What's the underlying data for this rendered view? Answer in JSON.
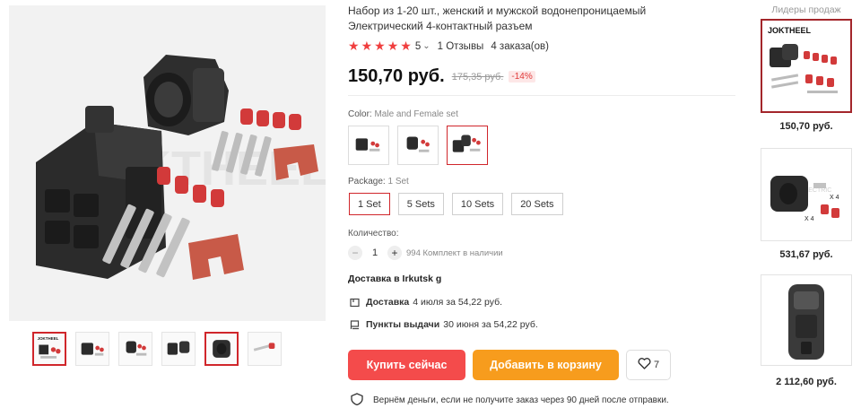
{
  "product": {
    "title": "Набор из 1-20 шт., женский и мужской водонепроницаемый Электрический 4-контактный разъем",
    "rating_value": "5",
    "reviews": "1 Отзывы",
    "orders": "4 заказа(ов)",
    "price": "150,70 руб.",
    "old_price": "175,35 руб.",
    "discount": "-14%",
    "watermark": "JOKTHEEL"
  },
  "gallery": {
    "thumb_count": 6,
    "active_index": 0
  },
  "color": {
    "label": "Color:",
    "selected": "Male and Female set",
    "options": [
      "female",
      "male",
      "male-and-female-set"
    ],
    "active_index": 2
  },
  "package": {
    "label": "Package:",
    "selected": "1 Set",
    "options": [
      "1 Set",
      "5 Sets",
      "10 Sets",
      "20 Sets"
    ],
    "active_index": 0
  },
  "quantity": {
    "label": "Количество:",
    "value": "1",
    "minus": "−",
    "plus": "+",
    "stock": "994 Комплект в наличии"
  },
  "delivery": {
    "heading": "Доставка в Irkutsk g",
    "courier_label": "Доставка",
    "courier_text": "4 июля за 54,22 руб.",
    "pickup_label": "Пункты выдачи",
    "pickup_text": "30 июня за 54,22 руб."
  },
  "actions": {
    "buy_now": "Купить сейчас",
    "add_to_cart": "Добавить в корзину",
    "wishlist_count": "7"
  },
  "guarantee": {
    "text": "Вернём деньги, если не получите заказ через 90 дней после отправки."
  },
  "sidebar": {
    "title": "Лидеры продаж",
    "items": [
      {
        "brand": "JOKTHEEL",
        "price": "150,70 руб."
      },
      {
        "brand": "ANZHE ELECTRIC",
        "price": "531,67 руб.",
        "qty_a": "X 4",
        "qty_b": "X 4"
      },
      {
        "price": "2 112,60 руб."
      }
    ]
  },
  "colors": {
    "accent_red": "#d0262b",
    "buy_button": "#f44b4b",
    "cart_button": "#f79c1d",
    "star": "#f03e3e"
  }
}
